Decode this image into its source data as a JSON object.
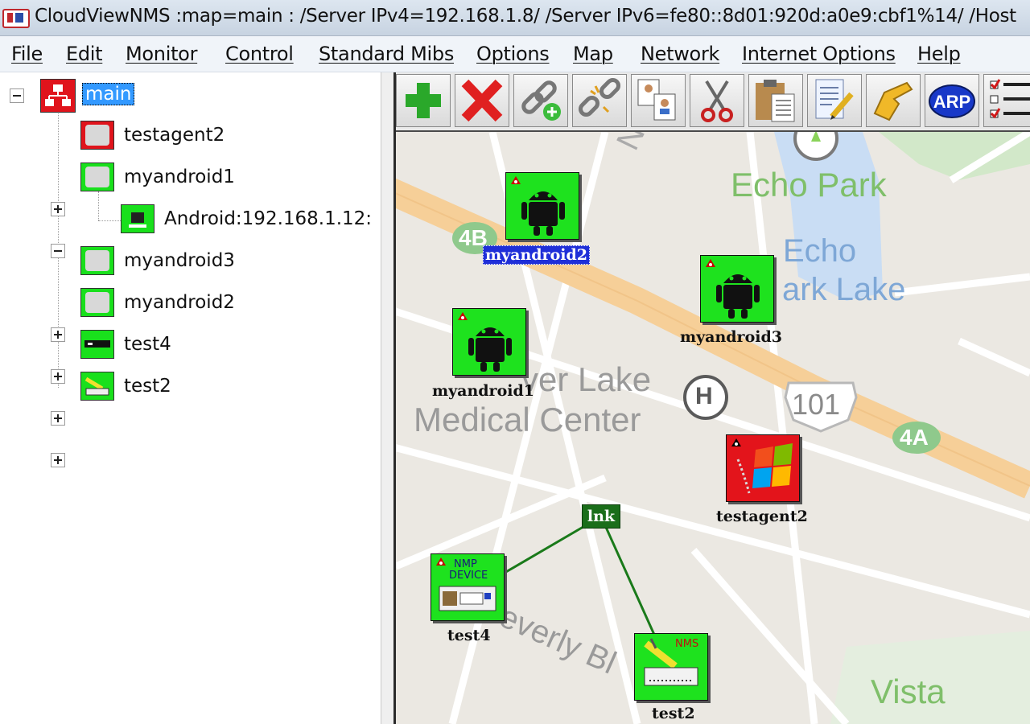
{
  "window": {
    "title": "CloudViewNMS :map=main :  /Server IPv4=192.168.1.8/ /Server IPv6=fe80::8d01:920d:a0e9:cbf1%14/ /Host"
  },
  "menu": [
    "File",
    "Edit",
    "Monitor",
    "Control",
    "Standard Mibs",
    "Options",
    "Map",
    "Network",
    "Internet Options",
    "Help"
  ],
  "tree": {
    "root": "main",
    "nodes": [
      {
        "label": "testagent2",
        "status": "red"
      },
      {
        "label": "myandroid1",
        "status": "green",
        "expanded": true,
        "child": "Android:192.168.1.12:"
      },
      {
        "label": "myandroid3",
        "status": "green"
      },
      {
        "label": "myandroid2",
        "status": "green"
      },
      {
        "label": "test4",
        "status": "green"
      },
      {
        "label": "test2",
        "status": "green"
      }
    ]
  },
  "toolbar": [
    {
      "icon": "add-icon"
    },
    {
      "icon": "delete-icon"
    },
    {
      "icon": "add-link-icon"
    },
    {
      "icon": "break-link-icon"
    },
    {
      "icon": "copy-device-icon"
    },
    {
      "icon": "cut-icon"
    },
    {
      "icon": "paste-icon"
    },
    {
      "icon": "edit-icon"
    },
    {
      "icon": "pointer-hand-icon"
    },
    {
      "icon": "arp-icon",
      "label": "ARP"
    },
    {
      "icon": "checklist-icon"
    }
  ],
  "map": {
    "places": {
      "echo_park": "Echo Park",
      "echo_park_lake_1": "Echo",
      "echo_park_lake_2": "ark Lake",
      "silver_lake_1": "ver Lake",
      "silver_lake_2": "Medical Center",
      "beverly": "everly Bl",
      "vista": "Vista",
      "hwy_101": "101",
      "exit_4a": "4A",
      "exit_4b": "4B",
      "hospital": "H",
      "street_n": "N"
    },
    "devices": [
      {
        "label": "myandroid2",
        "kind": "android",
        "status": "green",
        "selected": true
      },
      {
        "label": "myandroid3",
        "kind": "android",
        "status": "green"
      },
      {
        "label": "myandroid1",
        "kind": "android",
        "status": "green"
      },
      {
        "label": "testagent2",
        "kind": "windows",
        "status": "red"
      },
      {
        "label": "test4",
        "kind": "snmp-device",
        "status": "green",
        "badge": "NMP\nDEVICE"
      },
      {
        "label": "test2",
        "kind": "nms-device",
        "status": "green",
        "badge": "NMS"
      }
    ],
    "link_label": "lnk"
  },
  "colors": {
    "status_green": "#1ee21e",
    "status_red": "#e3141b",
    "link_green": "#1a6e1a",
    "selection_blue": "#1f2fd8"
  }
}
